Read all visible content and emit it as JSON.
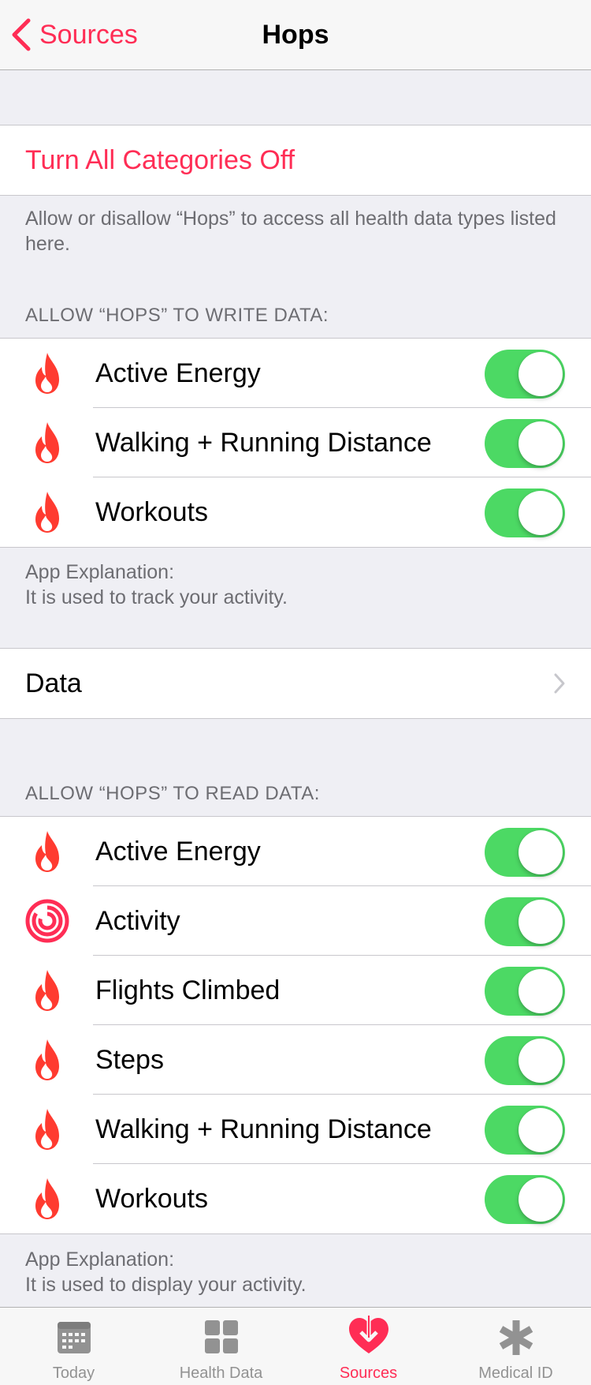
{
  "nav": {
    "back_label": "Sources",
    "title": "Hops"
  },
  "turn_off": {
    "label": "Turn All Categories Off"
  },
  "turn_off_footer": "Allow or disallow “Hops” to access all health data types listed here.",
  "write_section": {
    "header": "ALLOW “HOPS” TO WRITE DATA:",
    "items": [
      {
        "label": "Active Energy",
        "icon": "flame-icon",
        "on": true
      },
      {
        "label": "Walking + Running Distance",
        "icon": "flame-icon",
        "on": true
      },
      {
        "label": "Workouts",
        "icon": "flame-icon",
        "on": true
      }
    ],
    "footer_title": "App Explanation:",
    "footer_text": "It is used to track your activity."
  },
  "data_row": {
    "label": "Data"
  },
  "read_section": {
    "header": "ALLOW “HOPS” TO READ DATA:",
    "items": [
      {
        "label": "Active Energy",
        "icon": "flame-icon",
        "on": true
      },
      {
        "label": "Activity",
        "icon": "activity-rings-icon",
        "on": true
      },
      {
        "label": "Flights Climbed",
        "icon": "flame-icon",
        "on": true
      },
      {
        "label": "Steps",
        "icon": "flame-icon",
        "on": true
      },
      {
        "label": "Walking + Running Distance",
        "icon": "flame-icon",
        "on": true
      },
      {
        "label": "Workouts",
        "icon": "flame-icon",
        "on": true
      }
    ],
    "footer_title": "App Explanation:",
    "footer_text": "It is used to display your activity."
  },
  "tabbar": {
    "tabs": [
      {
        "label": "Today",
        "icon": "calendar-icon",
        "active": false
      },
      {
        "label": "Health Data",
        "icon": "grid-icon",
        "active": false
      },
      {
        "label": "Sources",
        "icon": "heart-download-icon",
        "active": true
      },
      {
        "label": "Medical ID",
        "icon": "asterisk-icon",
        "active": false
      }
    ]
  },
  "colors": {
    "accent": "#ff2d55",
    "toggle_on": "#4cd964",
    "flame": "#ff3b30",
    "tab_inactive": "#929292"
  }
}
